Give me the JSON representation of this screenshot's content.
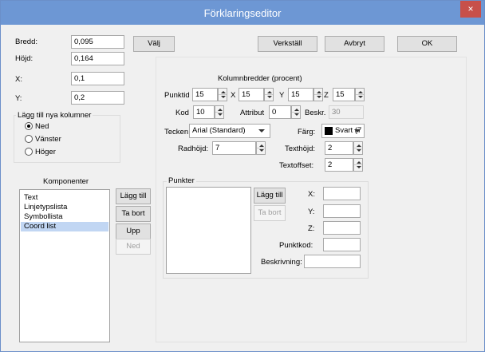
{
  "window": {
    "title": "Förklaringseditor",
    "close_glyph": "×"
  },
  "size": {
    "bredd_label": "Bredd:",
    "bredd_value": "0,095",
    "hojd_label": "Höjd:",
    "hojd_value": "0,164",
    "x_label": "X:",
    "x_value": "0,1",
    "y_label": "Y:",
    "y_value": "0,2",
    "valj_label": "Välj"
  },
  "actions": {
    "verkstall": "Verkställ",
    "avbryt": "Avbryt",
    "ok": "OK"
  },
  "new_columns": {
    "title": "Lägg till nya kolumner",
    "options": [
      {
        "label": "Ned",
        "selected": true
      },
      {
        "label": "Vänster",
        "selected": false
      },
      {
        "label": "Höger",
        "selected": false
      }
    ]
  },
  "components": {
    "title": "Komponenter",
    "items": [
      {
        "label": "Text",
        "selected": false
      },
      {
        "label": "Linjetypslista",
        "selected": false
      },
      {
        "label": "Symbollista",
        "selected": false
      },
      {
        "label": "Coord list",
        "selected": true
      }
    ],
    "add_label": "Lägg till",
    "remove_label": "Ta bort",
    "up_label": "Upp",
    "down_label": "Ned"
  },
  "columns": {
    "title": "Kolumnbredder (procent)",
    "punktid_label": "Punktid",
    "punktid_value": "15",
    "x_label": "X",
    "x_value": "15",
    "y_label": "Y",
    "y_value": "15",
    "z_label": "Z",
    "z_value": "15",
    "kod_label": "Kod",
    "kod_value": "10",
    "attribut_label": "Attribut",
    "attribut_value": "0",
    "beskr_label": "Beskr.",
    "beskr_value": "30"
  },
  "format": {
    "tecken_label": "Tecken:",
    "tecken_value": "Arial (Standard)",
    "farg_label": "Färg:",
    "farg_value": "Svart (7",
    "farg_color": "#000000",
    "radhojd_label": "Radhöjd:",
    "radhojd_value": "7",
    "texthojd_label": "Texthöjd:",
    "texthojd_value": "2",
    "textoffset_label": "Textoffset:",
    "textoffset_value": "2"
  },
  "points": {
    "title": "Punkter",
    "add_label": "Lägg till",
    "remove_label": "Ta bort",
    "x_label": "X:",
    "y_label": "Y:",
    "z_label": "Z:",
    "punktkod_label": "Punktkod:",
    "beskrivning_label": "Beskrivning:"
  }
}
